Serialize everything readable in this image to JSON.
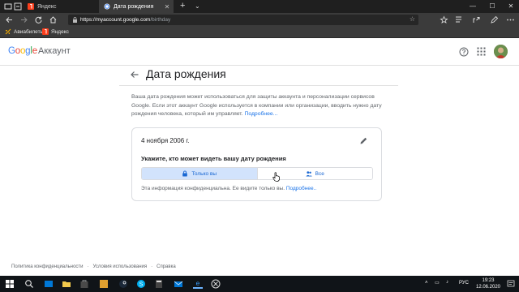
{
  "browser": {
    "tabs": [
      {
        "label": "Яндекс",
        "active": false
      },
      {
        "label": "Дата рождения",
        "active": true
      }
    ],
    "url_host": "https://myaccount.google.com",
    "url_path": "/birthday",
    "bookmarks": [
      {
        "label": "Авиабилеты",
        "icon": "plane-icon"
      },
      {
        "label": "Яндекс",
        "icon": "yandex-icon"
      }
    ]
  },
  "header": {
    "logo_text": "Google",
    "product": "Аккаунт"
  },
  "page": {
    "title": "Дата рождения",
    "description": "Ваша дата рождения может использоваться для защиты аккаунта и персонализации сервисов Google. Если этот аккаунт Google используется в компании или организации, вводить нужно дату рождения человека, который им управляет.",
    "description_link": "Подробнее..."
  },
  "card": {
    "birthday": "4 ноября 2006 г.",
    "visibility_heading": "Укажите, кто может видеть вашу дату рождения",
    "options": [
      {
        "label": "Только вы",
        "icon": "lock-icon",
        "selected": true
      },
      {
        "label": "Все",
        "icon": "people-icon",
        "selected": false
      }
    ],
    "privacy_note": "Эта информация конфиденциальна. Ее видите только вы.",
    "privacy_link": "Подробнее.."
  },
  "footer": {
    "links": [
      "Политика конфиденциальности",
      "Условия использования",
      "Справка"
    ]
  },
  "taskbar": {
    "language": "РУС",
    "time": "19:23",
    "date": "12.06.2020"
  },
  "colors": {
    "accent": "#1a73e8",
    "selected_bg": "#d2e3fc",
    "chrome_dark": "#1f1f1f",
    "chrome_mid": "#3b3b3b"
  }
}
